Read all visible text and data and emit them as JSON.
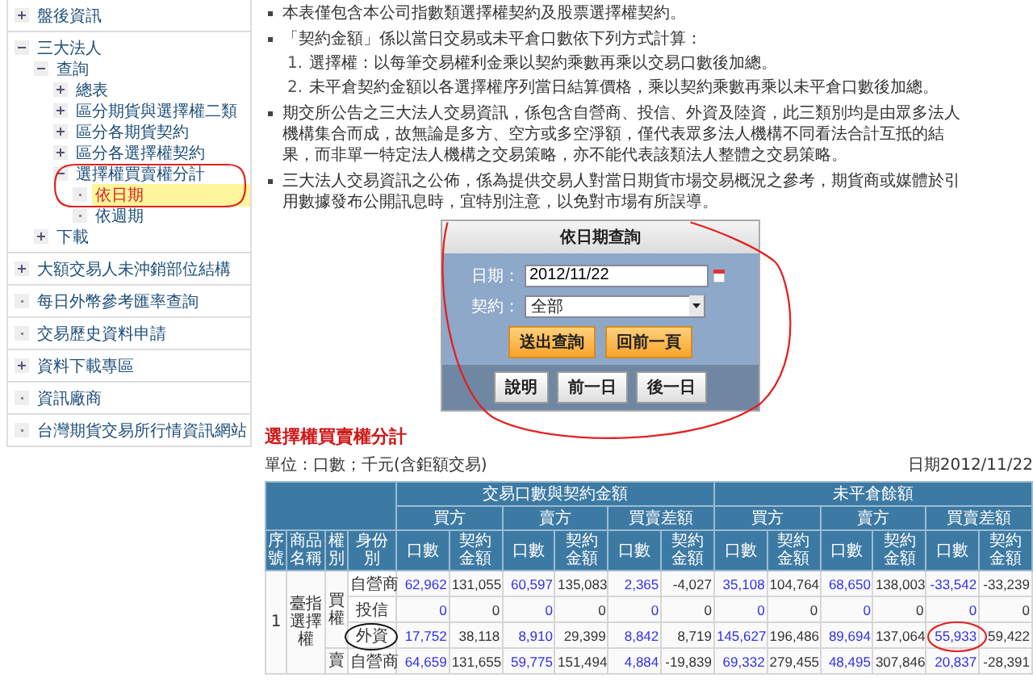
{
  "sidebar": {
    "items": [
      {
        "label": "盤後資訊",
        "kind": "folder",
        "expanded": false
      },
      {
        "label": "三大法人",
        "kind": "folder",
        "expanded": true,
        "children": [
          {
            "label": "查詢",
            "kind": "folder",
            "expanded": true,
            "children": [
              {
                "label": "總表",
                "kind": "folder",
                "expanded": false
              },
              {
                "label": "區分期貨與選擇權二類",
                "kind": "folder",
                "expanded": false
              },
              {
                "label": "區分各期貨契約",
                "kind": "folder",
                "expanded": false
              },
              {
                "label": "區分各選擇權契約",
                "kind": "folder",
                "expanded": false
              },
              {
                "label": "選擇權買賣權分計",
                "kind": "folder",
                "expanded": true,
                "children": [
                  {
                    "label": "依日期",
                    "kind": "leaf",
                    "selected": true
                  },
                  {
                    "label": "依週期",
                    "kind": "leaf",
                    "selected": false
                  }
                ]
              }
            ]
          },
          {
            "label": "下載",
            "kind": "folder",
            "expanded": false
          }
        ]
      },
      {
        "label": "大額交易人未沖銷部位結構",
        "kind": "folder",
        "expanded": false
      },
      {
        "label": "每日外幣參考匯率查詢",
        "kind": "leaf"
      },
      {
        "label": "交易歷史資料申請",
        "kind": "leaf"
      },
      {
        "label": "資料下載專區",
        "kind": "folder",
        "expanded": false
      },
      {
        "label": "資訊廠商",
        "kind": "leaf"
      },
      {
        "label": "台灣期貨交易所行情資訊網站",
        "kind": "leaf"
      }
    ]
  },
  "notes": [
    {
      "text": "本表僅包含本公司指數類選擇權契約及股票選擇權契約。"
    },
    {
      "text": "「契約金額」係以當日交易或未平倉口數依下列方式計算：",
      "steps": [
        {
          "number": "1.",
          "text": "選擇權：以每筆交易權利金乘以契約乘數再乘以交易口數後加總。"
        },
        {
          "number": "2.",
          "text": "未平倉契約金額以各選擇權序列當日結算價格，乘以契約乘數再乘以未平倉口數後加總。"
        }
      ]
    },
    {
      "text": "期交所公告之三大法人交易資訊，係包含自營商、投信、外資及陸資，此三類別均是由眾多法人機構集合而成，故無論是多方、空方或多空淨額，僅代表眾多法人機構不同看法合計互抵的結果，而非單一特定法人機構之交易策略，亦不能代表該類法人整體之交易策略。"
    },
    {
      "text": "三大法人交易資訊之公佈，係為提供交易人對當日期貨市場交易概況之參考，期貨商或媒體於引用數據發布公開訊息時，宜特別注意，以免對市場有所誤導。"
    }
  ],
  "query_dialog": {
    "title": "依日期查詢",
    "date_label": "日期：",
    "date_value": "2012/11/22",
    "contract_label": "契約：",
    "contract_value": "全部",
    "actions": [
      "送出查詢",
      "回前一頁"
    ],
    "nav_buttons": [
      "說明",
      "前一日",
      "後一日"
    ]
  },
  "report": {
    "title": "選擇權買賣權分計",
    "unit": "單位：口數；千元(含鉅額交易)",
    "date": "日期2012/11/22",
    "groups": [
      "交易口數與契約金額",
      "未平倉餘額"
    ],
    "sides": [
      "買方",
      "賣方",
      "買賣差額",
      "買方",
      "賣方",
      "買賣差額"
    ],
    "lead_columns": [
      "序號",
      "商品名稱",
      "權別",
      "身份別"
    ],
    "value_columns": [
      "口數",
      "契約金額",
      "口數",
      "契約金額",
      "口數",
      "契約金額",
      "口數",
      "契約金額",
      "口數",
      "契約金額",
      "口數",
      "契約金額"
    ],
    "products": [
      {
        "number": "1",
        "name": "臺指選擇權",
        "rights": [
          {
            "label": "買權",
            "rows": [
              {
                "identity": "自營商",
                "values": [
                  "62,962",
                  "131,055",
                  "60,597",
                  "135,083",
                  "2,365",
                  "-4,027",
                  "35,108",
                  "104,764",
                  "68,650",
                  "138,003",
                  "-33,542",
                  "-33,239"
                ]
              },
              {
                "identity": "投信",
                "values": [
                  "0",
                  "0",
                  "0",
                  "0",
                  "0",
                  "0",
                  "0",
                  "0",
                  "0",
                  "0",
                  "0",
                  "0"
                ]
              },
              {
                "identity": "外資",
                "values": [
                  "17,752",
                  "38,118",
                  "8,910",
                  "29,399",
                  "8,842",
                  "8,719",
                  "145,627",
                  "196,486",
                  "89,694",
                  "137,064",
                  "55,933",
                  "59,422"
                ]
              }
            ]
          },
          {
            "label": "賣",
            "rows": [
              {
                "identity": "自營商",
                "values": [
                  "64,659",
                  "131,655",
                  "59,775",
                  "151,494",
                  "4,884",
                  "-19,839",
                  "69,332",
                  "279,455",
                  "48,495",
                  "307,846",
                  "20,837",
                  "-28,391"
                ]
              }
            ]
          }
        ]
      }
    ]
  }
}
